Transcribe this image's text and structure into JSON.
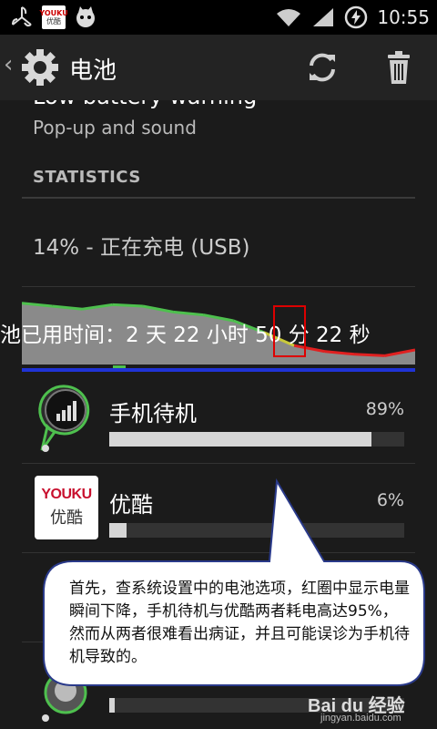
{
  "status_bar": {
    "time": "10:55",
    "youku_mini_top": "YOUKU",
    "youku_mini_bottom": "优酷"
  },
  "action_bar": {
    "title": "电池"
  },
  "settings": {
    "low_battery_title": "Low battery warning",
    "low_battery_subtitle": "Pop-up and sound",
    "section_header": "STATISTICS",
    "charging_status": "14% - 正在充电 (USB)",
    "battery_use_time": "池已用时间：2 天 22 小时 50 分 22 秒"
  },
  "battery_graph": {
    "level_trend": [
      0.84,
      0.8,
      0.76,
      0.82,
      0.8,
      0.72,
      0.68,
      0.6,
      0.44,
      0.26,
      0.18,
      0.14,
      0.12,
      0.2
    ],
    "line_color_high": "#4ec04e",
    "line_color_mid": "#c9c93a",
    "line_color_low": "#e02020"
  },
  "apps": [
    {
      "name": "手机待机",
      "percent": "89%",
      "fraction": 0.89
    },
    {
      "name": "优酷",
      "percent": "6%",
      "fraction": 0.06,
      "icon_top": "YOUKU",
      "icon_bottom": "优酷"
    },
    {
      "name": "",
      "percent": "",
      "fraction": 0.02
    }
  ],
  "callout": {
    "text": "首先，查系统设置中的电池选项，红圈中显示电量瞬间下降，手机待机与优酷两者耗电高达95%，然而从两者很难看出病证，并且可能误诊为手机待机导致的。",
    "fill_color": "#ffffff",
    "border_color": "#2a3a8a"
  },
  "watermark": {
    "brand": "Bai du 经验",
    "url": "jingyan.baidu.com"
  },
  "colors": {
    "action_bar_bg": "#232323",
    "content_bg": "#1b1b1b",
    "highlight_box": "#dd0000"
  }
}
